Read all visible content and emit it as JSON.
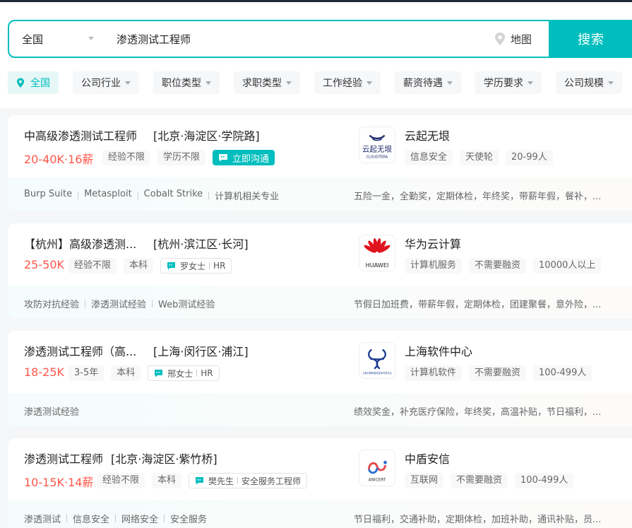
{
  "search": {
    "city": "全国",
    "query": "渗透测试工程师",
    "map_label": "地图",
    "button_label": "搜索"
  },
  "filters": [
    {
      "label": "全国",
      "active": true
    },
    {
      "label": "公司行业"
    },
    {
      "label": "职位类型"
    },
    {
      "label": "求职类型"
    },
    {
      "label": "工作经验"
    },
    {
      "label": "薪资待遇"
    },
    {
      "label": "学历要求"
    },
    {
      "label": "公司规模"
    }
  ],
  "jobs": [
    {
      "title": "中高级渗透测试工程师",
      "area": "[北京·海淀区·学院路]",
      "salary": "20-40K·16薪",
      "tags": [
        "经验不限",
        "学历不限"
      ],
      "chat_label": "立即沟通",
      "company": "云起无垠",
      "company_tags": [
        "信息安全",
        "天使轮",
        "20-99人"
      ],
      "logo_text": "云起无垠",
      "logo_subtext": "CLOUDITERA",
      "skills": [
        "Burp Suite",
        "Metasploit",
        "Cobalt Strike",
        "计算机相关专业"
      ],
      "welfare": "五险一金，全勤奖，定期体检，年终奖，带薪年假，餐补，..."
    },
    {
      "title": "【杭州】高级渗透测...",
      "area": "[杭州·滨江区·长河]",
      "salary": "25-50K",
      "tags": [
        "经验不限",
        "本科"
      ],
      "hr_name": "罗女士",
      "hr_title": "HR",
      "company": "华为云计算",
      "company_tags": [
        "计算机服务",
        "不需要融资",
        "10000人以上"
      ],
      "logo_text": "HUAWEI",
      "skills": [
        "攻防对抗经验",
        "渗透测试经验",
        "Web测试经验"
      ],
      "welfare": "节假日加班费，带薪年假，定期体检，团建聚餐，意外险，..."
    },
    {
      "title": "渗透测试工程师（高...",
      "area": "[上海·闵行区·浦江]",
      "salary": "18-25K",
      "tags": [
        "3-5年",
        "本科"
      ],
      "hr_name": "邢女士",
      "hr_title": "HR",
      "company": "上海软件中心",
      "company_tags": [
        "计算机软件",
        "不需要融资",
        "100-499人"
      ],
      "logo_text": "上海计算机软件技术开发中心",
      "skills": [
        "渗透测试经验"
      ],
      "welfare": "绩效奖金，补充医疗保险，年终奖，高温补贴，节日福利，..."
    },
    {
      "title": "渗透测试工程师",
      "area": "[北京·海淀区·紫竹桥]",
      "salary": "10-15K·14薪",
      "tags": [
        "经验不限",
        "本科"
      ],
      "hr_name": "樊先生",
      "hr_title": "安全服务工程师",
      "company": "中盾安信",
      "company_tags": [
        "互联网",
        "不需要融资",
        "100-499人"
      ],
      "logo_text": "ANICERT",
      "skills": [
        "渗透测试",
        "信息安全",
        "网络安全",
        "安全服务"
      ],
      "welfare": "节日福利，交通补助，定期体检，加班补助，通讯补贴，员..."
    }
  ],
  "colors": {
    "brand": "#00bebd",
    "salary": "#fe574a"
  }
}
